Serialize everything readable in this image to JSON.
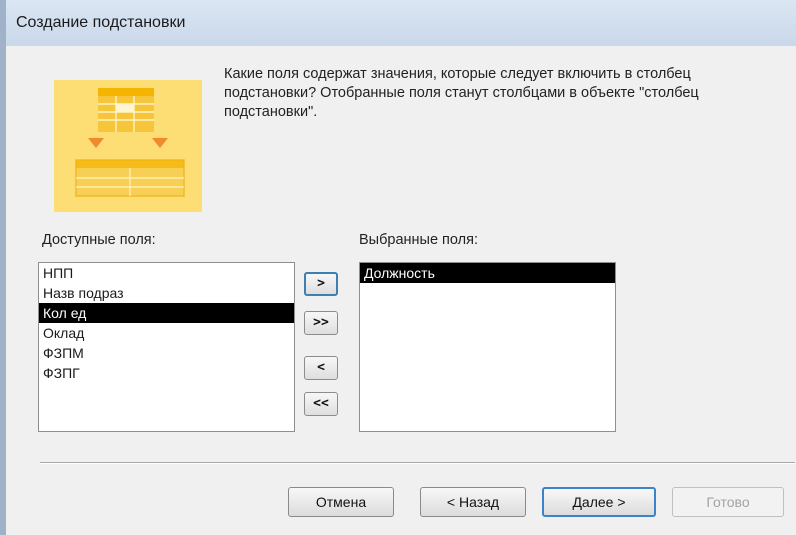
{
  "window": {
    "title": "Создание подстановки"
  },
  "question": "Какие поля содержат значения, которые следует включить в столбец подстановки? Отобранные поля станут столбцами в объекте \"столбец подстановки\".",
  "available": {
    "label": "Доступные поля:",
    "items": [
      {
        "label": "НПП",
        "selected": false
      },
      {
        "label": "Назв подраз",
        "selected": false
      },
      {
        "label": "Кол ед",
        "selected": true
      },
      {
        "label": "Оклад",
        "selected": false
      },
      {
        "label": "ФЗПМ",
        "selected": false
      },
      {
        "label": "ФЗПГ",
        "selected": false
      }
    ]
  },
  "selected": {
    "label": "Выбранные поля:",
    "items": [
      {
        "label": "Должность",
        "selected": true
      }
    ]
  },
  "move_buttons": {
    "add_one": ">",
    "add_all": ">>",
    "remove_one": "<",
    "remove_all": "<<"
  },
  "buttons": {
    "cancel": "Отмена",
    "back": "< Назад",
    "next": "Далее >",
    "finish": "Готово"
  }
}
